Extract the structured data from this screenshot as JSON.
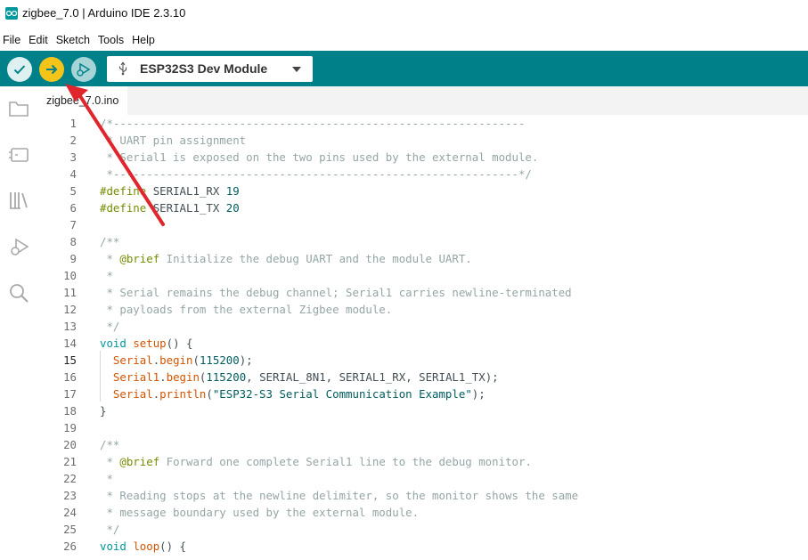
{
  "window": {
    "title": "zigbee_7.0 | Arduino IDE 2.3.10"
  },
  "menu": [
    "File",
    "Edit",
    "Sketch",
    "Tools",
    "Help"
  ],
  "toolbar": {
    "board": "ESP32S3 Dev Module"
  },
  "tab": {
    "label": "zigbee_7.0.ino"
  },
  "editor": {
    "active_line": 15,
    "lines": [
      {
        "n": "1",
        "spans": [
          {
            "c": "c-comment",
            "t": "/*--------------------------------------------------------------"
          }
        ]
      },
      {
        "n": "2",
        "spans": [
          {
            "c": "c-comment",
            "t": " * UART pin assignment"
          }
        ]
      },
      {
        "n": "3",
        "spans": [
          {
            "c": "c-comment",
            "t": " * Serial1 is exposed on the two pins used by the external module."
          }
        ]
      },
      {
        "n": "4",
        "spans": [
          {
            "c": "c-comment",
            "t": " *-------------------------------------------------------------*/"
          }
        ]
      },
      {
        "n": "5",
        "spans": [
          {
            "c": "c-pre",
            "t": "#define "
          },
          {
            "c": "c-id",
            "t": "SERIAL1_RX "
          },
          {
            "c": "c-num",
            "t": "19"
          }
        ]
      },
      {
        "n": "6",
        "spans": [
          {
            "c": "c-pre",
            "t": "#define "
          },
          {
            "c": "c-id",
            "t": "SERIAL1_TX "
          },
          {
            "c": "c-num",
            "t": "20"
          }
        ]
      },
      {
        "n": "7",
        "spans": []
      },
      {
        "n": "8",
        "spans": [
          {
            "c": "c-comment",
            "t": "/**"
          }
        ]
      },
      {
        "n": "9",
        "spans": [
          {
            "c": "c-comment",
            "t": " * "
          },
          {
            "c": "c-tag",
            "t": "@brief"
          },
          {
            "c": "c-comment",
            "t": " Initialize the debug UART and the module UART."
          }
        ]
      },
      {
        "n": "10",
        "spans": [
          {
            "c": "c-comment",
            "t": " *"
          }
        ]
      },
      {
        "n": "11",
        "spans": [
          {
            "c": "c-comment",
            "t": " * Serial remains the debug channel; Serial1 carries newline-terminated"
          }
        ]
      },
      {
        "n": "12",
        "spans": [
          {
            "c": "c-comment",
            "t": " * payloads from the external Zigbee module."
          }
        ]
      },
      {
        "n": "13",
        "spans": [
          {
            "c": "c-comment",
            "t": " */"
          }
        ]
      },
      {
        "n": "14",
        "spans": [
          {
            "c": "c-type",
            "t": "void "
          },
          {
            "c": "c-fn",
            "t": "setup"
          },
          {
            "c": "c-id",
            "t": "() {"
          }
        ]
      },
      {
        "n": "15",
        "spans": [
          {
            "c": "c-fn",
            "t": "  Serial"
          },
          {
            "c": "c-id",
            "t": "."
          },
          {
            "c": "c-fn",
            "t": "begin"
          },
          {
            "c": "c-id",
            "t": "("
          },
          {
            "c": "c-num",
            "t": "115200"
          },
          {
            "c": "c-id",
            "t": ");"
          }
        ]
      },
      {
        "n": "16",
        "spans": [
          {
            "c": "c-fn",
            "t": "  Serial1"
          },
          {
            "c": "c-id",
            "t": "."
          },
          {
            "c": "c-fn",
            "t": "begin"
          },
          {
            "c": "c-id",
            "t": "("
          },
          {
            "c": "c-num",
            "t": "115200"
          },
          {
            "c": "c-id",
            "t": ", SERIAL_8N1, SERIAL1_RX, SERIAL1_TX);"
          }
        ]
      },
      {
        "n": "17",
        "spans": [
          {
            "c": "c-fn",
            "t": "  Serial"
          },
          {
            "c": "c-id",
            "t": "."
          },
          {
            "c": "c-fn",
            "t": "println"
          },
          {
            "c": "c-id",
            "t": "("
          },
          {
            "c": "c-str",
            "t": "\"ESP32-S3 Serial Communication Example\""
          },
          {
            "c": "c-id",
            "t": ");"
          }
        ]
      },
      {
        "n": "18",
        "spans": [
          {
            "c": "c-id",
            "t": "}"
          }
        ]
      },
      {
        "n": "19",
        "spans": []
      },
      {
        "n": "20",
        "spans": [
          {
            "c": "c-comment",
            "t": "/**"
          }
        ]
      },
      {
        "n": "21",
        "spans": [
          {
            "c": "c-comment",
            "t": " * "
          },
          {
            "c": "c-tag",
            "t": "@brief"
          },
          {
            "c": "c-comment",
            "t": " Forward one complete Serial1 line to the debug monitor."
          }
        ]
      },
      {
        "n": "22",
        "spans": [
          {
            "c": "c-comment",
            "t": " *"
          }
        ]
      },
      {
        "n": "23",
        "spans": [
          {
            "c": "c-comment",
            "t": " * Reading stops at the newline delimiter, so the monitor shows the same"
          }
        ]
      },
      {
        "n": "24",
        "spans": [
          {
            "c": "c-comment",
            "t": " * message boundary used by the external module."
          }
        ]
      },
      {
        "n": "25",
        "spans": [
          {
            "c": "c-comment",
            "t": " */"
          }
        ]
      },
      {
        "n": "26",
        "spans": [
          {
            "c": "c-type",
            "t": "void "
          },
          {
            "c": "c-fn",
            "t": "loop"
          },
          {
            "c": "c-id",
            "t": "() {"
          }
        ]
      }
    ]
  },
  "annotation": {
    "color": "#e0262c"
  }
}
